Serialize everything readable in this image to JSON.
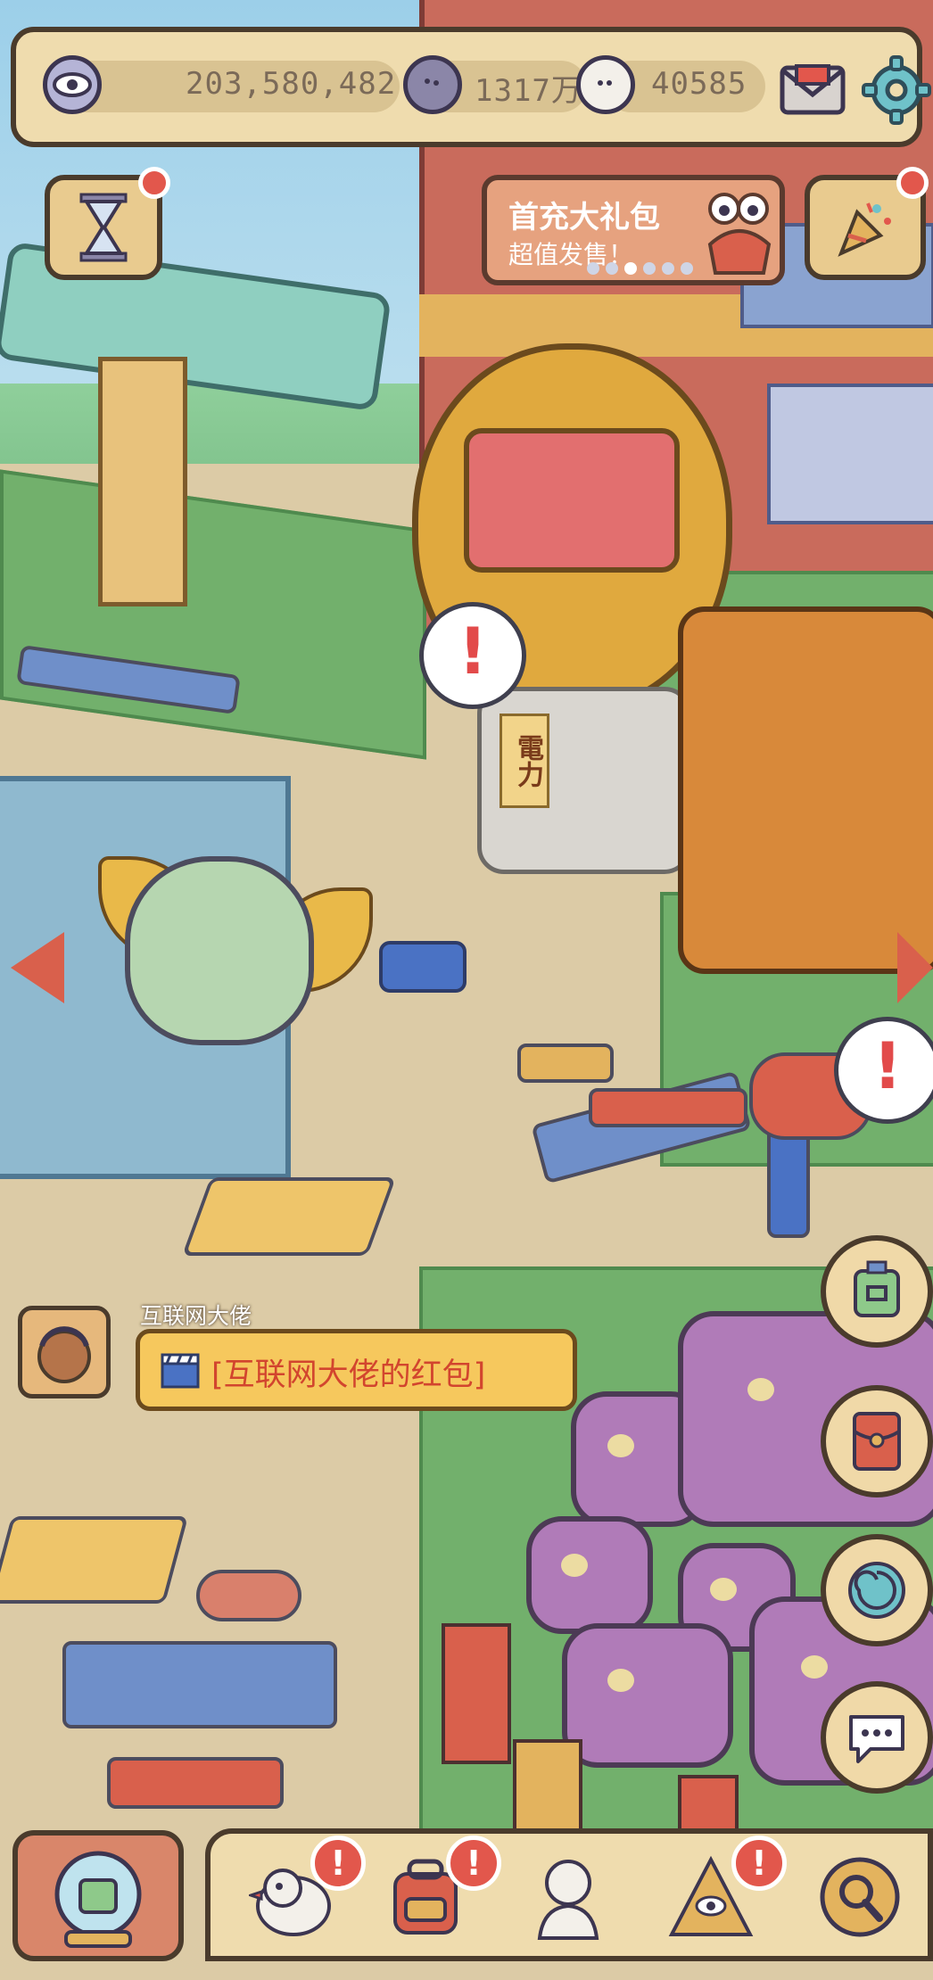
{
  "hud": {
    "eye_value": "203,580,482",
    "coin_value": "1317万",
    "bubble_value": "40585",
    "icons": [
      "eye-icon",
      "coin-icon",
      "ghost-bubble-icon",
      "mail-icon",
      "gear-icon"
    ]
  },
  "promo": {
    "title": "首充大礼包",
    "subtitle": "超值发售！",
    "carousel_count": 6,
    "carousel_active": 2
  },
  "scene": {
    "rock_label": "電力",
    "alert_mark": "!"
  },
  "chat": {
    "sender": "互联网大佬",
    "message": "[互联网大佬的红包]"
  },
  "bottom_nav": {
    "alert_mark": "!",
    "items": [
      "duck-character",
      "backpack",
      "statue",
      "pyramid-eye",
      "magnifier-coin"
    ]
  },
  "colors": {
    "panel": "#efdcae",
    "outline": "#4a3b2c",
    "alert_red": "#e2574c",
    "chat_text": "#d2452e",
    "chat_bubble": "#f6c85d"
  }
}
